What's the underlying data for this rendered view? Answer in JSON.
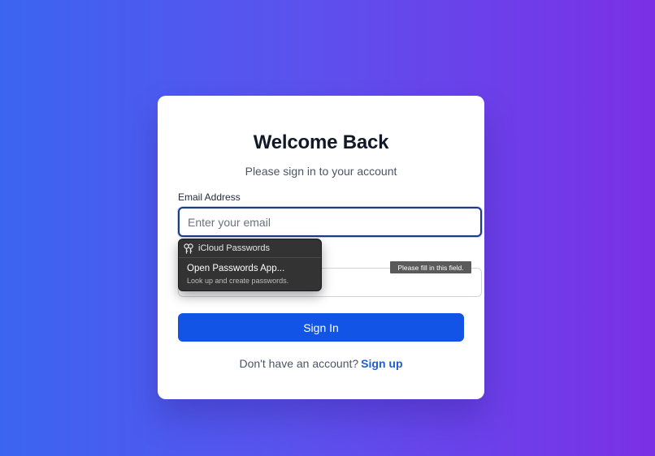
{
  "login": {
    "title": "Welcome Back",
    "subtitle": "Please sign in to your account",
    "email_label": "Email Address",
    "email_placeholder": "Enter your email",
    "email_value": "",
    "password_value": "",
    "signin_label": "Sign In",
    "footer_text": "Don't have an account?",
    "signup_link": "Sign up"
  },
  "autofill_popup": {
    "header_icon": "key-icon",
    "header": "iCloud Passwords",
    "item_title": "Open Passwords App...",
    "item_desc": "Look up and create passwords."
  },
  "validation_tooltip": {
    "text": "Please fill in this field."
  },
  "colors": {
    "accent": "#1154e6",
    "link": "#1d5fd6",
    "focus_border": "#1e3a8a"
  }
}
